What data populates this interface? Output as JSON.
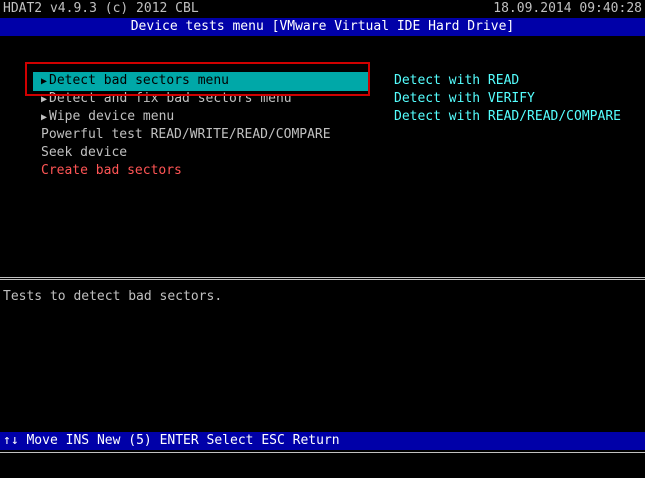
{
  "header": {
    "app_title": "HDAT2 v4.9.3 (c) 2012 CBL",
    "datetime": "18.09.2014 09:40:28"
  },
  "title_bar": {
    "text": "Device tests menu [VMware Virtual IDE Hard Drive]"
  },
  "menu": {
    "items": [
      {
        "label": "Detect bad sectors menu",
        "has_submenu": true
      },
      {
        "label": "Detect and fix bad sectors menu",
        "has_submenu": true
      },
      {
        "label": "Wipe device menu",
        "has_submenu": true
      },
      {
        "label": "Powerful test READ/WRITE/READ/COMPARE",
        "has_submenu": false
      },
      {
        "label": "Seek device",
        "has_submenu": false
      },
      {
        "label": "Create bad sectors",
        "has_submenu": false
      }
    ],
    "selected_index": 0
  },
  "submenu": {
    "items": [
      "Detect with READ",
      "Detect with VERIFY",
      "Detect with READ/READ/COMPARE"
    ]
  },
  "help_text": "Tests to detect bad sectors.",
  "footer": {
    "arrows_key": "↑↓",
    "move_label": "Move",
    "ins_key": "INS",
    "new_label": "New",
    "five_key": "(5)",
    "enter_key": "ENTER",
    "select_label": "Select",
    "esc_key": "ESC",
    "return_label": "Return"
  },
  "colors": {
    "bar_blue": "#0000a8",
    "selected_cyan": "#00a8a8",
    "submenu_cyan": "#55ffff",
    "danger_red": "#ff5555",
    "annotation_red": "#d00000"
  },
  "icons": {
    "submenu_arrow": "right-triangle-icon"
  }
}
